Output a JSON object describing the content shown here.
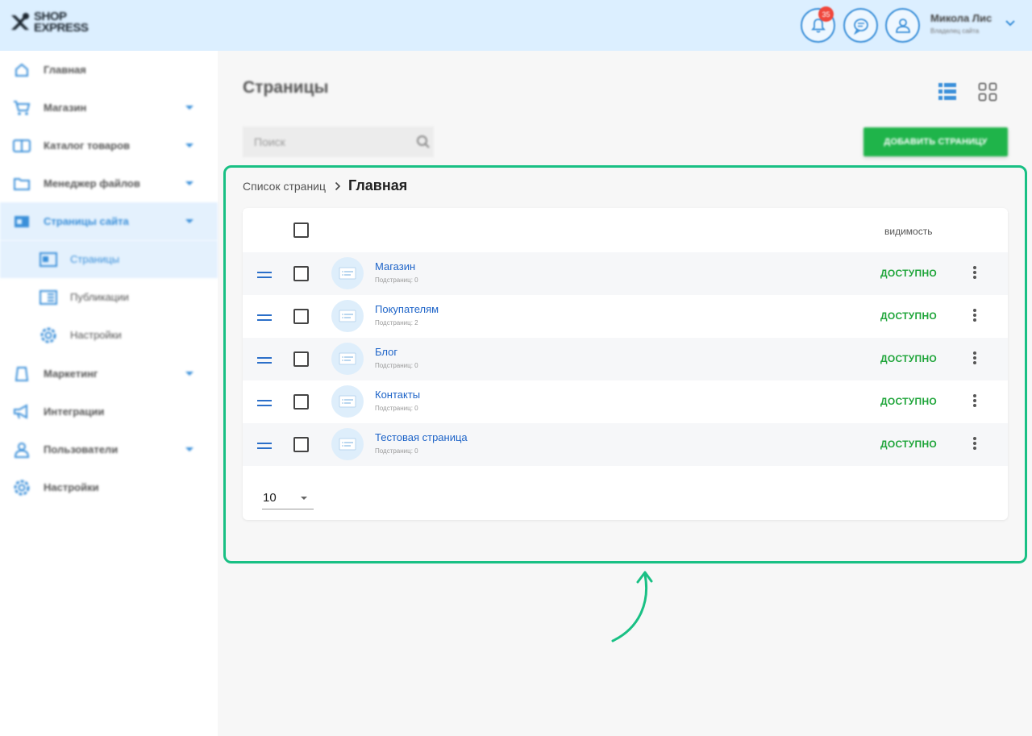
{
  "header": {
    "logo_line1": "SHOP",
    "logo_line2": "EXPRESS",
    "notifications_count": "35",
    "user_name": "Микола Лис",
    "user_role": "Владелец сайта"
  },
  "sidebar": {
    "items": [
      {
        "label": "Главная",
        "icon": "home-icon"
      },
      {
        "label": "Магазин",
        "icon": "cart-icon"
      },
      {
        "label": "Каталог товаров",
        "icon": "catalog-icon"
      },
      {
        "label": "Менеджер файлов",
        "icon": "folder-icon"
      },
      {
        "label": "Страницы сайта",
        "icon": "pages-icon"
      },
      {
        "label": "Страницы",
        "icon": "page-icon"
      },
      {
        "label": "Публикации",
        "icon": "publications-icon"
      },
      {
        "label": "Настройки",
        "icon": "settings-icon"
      },
      {
        "label": "Маркетинг",
        "icon": "marketing-icon"
      },
      {
        "label": "Интеграции",
        "icon": "megaphone-icon"
      },
      {
        "label": "Пользователи",
        "icon": "users-icon"
      },
      {
        "label": "Настройки",
        "icon": "gear-icon"
      }
    ]
  },
  "main": {
    "title": "Страницы",
    "search_placeholder": "Поиск",
    "add_button": "ДОБАВИТЬ СТРАНИЦУ",
    "breadcrumb_parent": "Список страниц",
    "breadcrumb_current": "Главная",
    "col_visibility": "видимость",
    "rows": [
      {
        "title": "Магазин",
        "sub": "Подстраниц: 0",
        "status": "ДОСТУПНО"
      },
      {
        "title": "Покупателям",
        "sub": "Подстраниц: 2",
        "status": "ДОСТУПНО"
      },
      {
        "title": "Блог",
        "sub": "Подстраниц: 0",
        "status": "ДОСТУПНО"
      },
      {
        "title": "Контакты",
        "sub": "Подстраниц: 0",
        "status": "ДОСТУПНО"
      },
      {
        "title": "Тестовая страница",
        "sub": "Подстраниц: 0",
        "status": "ДОСТУПНО"
      }
    ],
    "per_page": "10"
  },
  "colors": {
    "accent": "#3a8fd9",
    "success": "#1fb44a",
    "highlight": "#19c084",
    "link": "#1e64c8"
  }
}
